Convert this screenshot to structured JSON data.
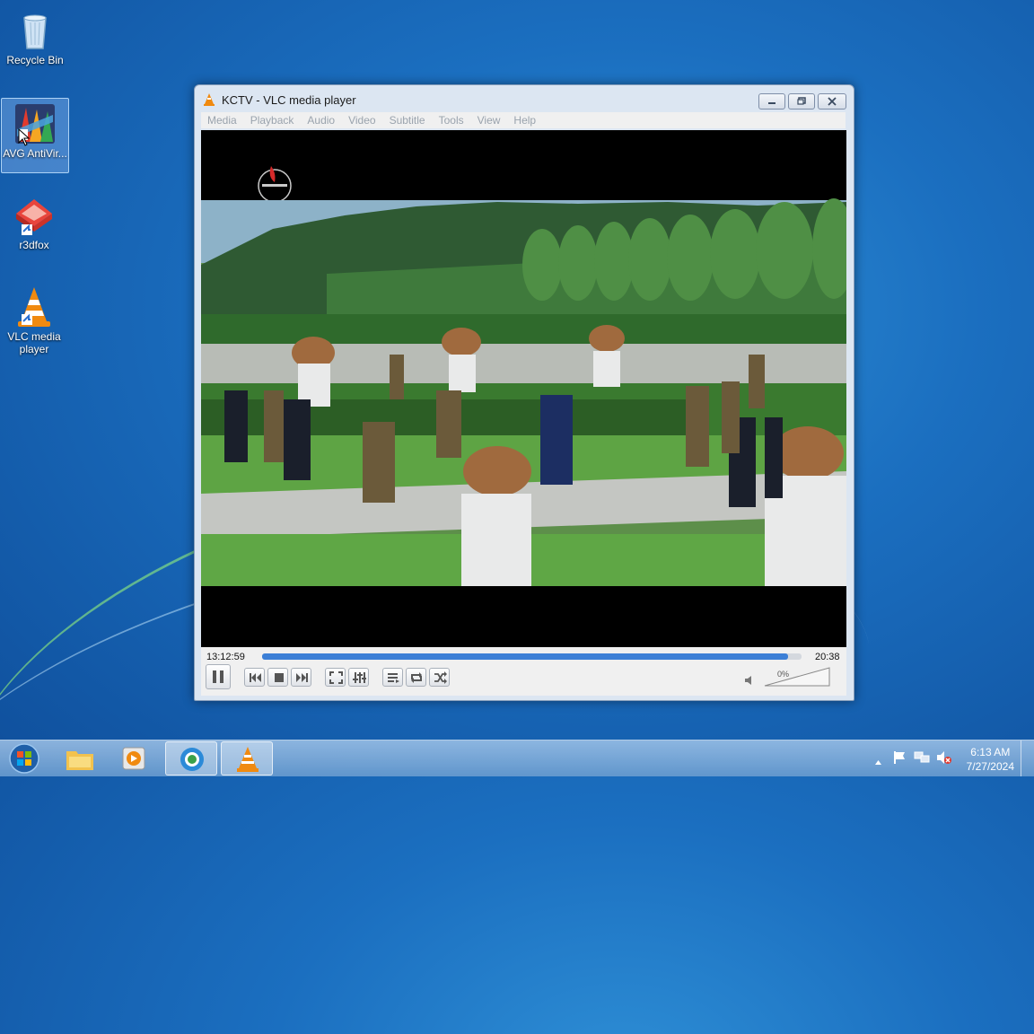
{
  "desktop": {
    "icons": [
      {
        "label": "Recycle Bin",
        "icon": "recycle-bin-icon"
      },
      {
        "label": "AVG AntiVir...",
        "icon": "avg-antivirus-icon"
      },
      {
        "label": "r3dfox",
        "icon": "r3dfox-icon"
      },
      {
        "label": "VLC media player",
        "icon": "vlc-icon"
      }
    ]
  },
  "window": {
    "title": "KCTV - VLC media player",
    "menu": [
      "Media",
      "Playback",
      "Audio",
      "Video",
      "Subtitle",
      "Tools",
      "View",
      "Help"
    ],
    "player": {
      "elapsed": "13:12:59",
      "remaining": "20:38",
      "progress": 0.975,
      "volume_text": "0%",
      "muted": true
    }
  },
  "taskbar": {
    "time": "6:13 AM",
    "date": "7/27/2024",
    "items": [
      "start-orb-icon",
      "explorer-icon",
      "media-player-icon",
      "browser-icon",
      "vlc-icon"
    ]
  },
  "colors": {
    "accent": "#3c7fd6",
    "vlc_orange": "#f08a10"
  }
}
